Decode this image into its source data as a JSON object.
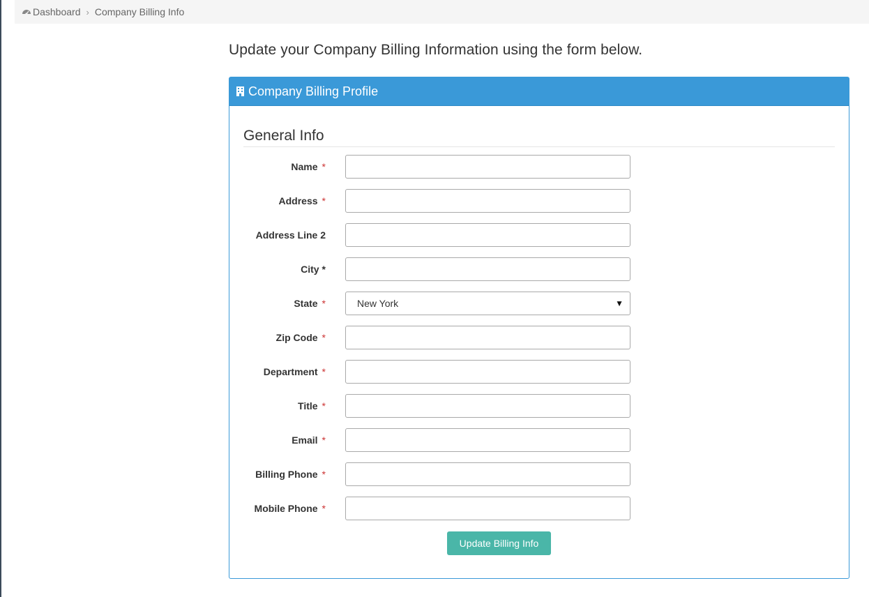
{
  "breadcrumb": {
    "home_icon": "dashboard-icon",
    "home_label": "Dashboard",
    "separator": "›",
    "current": "Company Billing Info"
  },
  "intro": "Update your Company Billing Information using the form below.",
  "panel": {
    "icon": "building-icon",
    "title": "Company Billing Profile",
    "header_color": "#3a99d8"
  },
  "section_title": "General Info",
  "fields": {
    "name": {
      "label": "Name",
      "required": "*",
      "value": ""
    },
    "address": {
      "label": "Address",
      "required": "*",
      "value": ""
    },
    "address2": {
      "label": "Address Line 2",
      "value": ""
    },
    "city": {
      "label": "City",
      "required": "*",
      "value": ""
    },
    "state": {
      "label": "State",
      "required": "*",
      "value": "New York",
      "caret": "▼"
    },
    "zip": {
      "label": "Zip Code",
      "required": "*",
      "value": ""
    },
    "department": {
      "label": "Department",
      "required": "*",
      "value": ""
    },
    "title": {
      "label": "Title",
      "required": "*",
      "value": ""
    },
    "email": {
      "label": "Email",
      "required": "*",
      "value": ""
    },
    "billing_phone": {
      "label": "Billing Phone",
      "required": "*",
      "value": ""
    },
    "mobile_phone": {
      "label": "Mobile Phone",
      "required": "*",
      "value": ""
    }
  },
  "submit_label": "Update Billing Info",
  "submit_color": "#4ab6a8"
}
